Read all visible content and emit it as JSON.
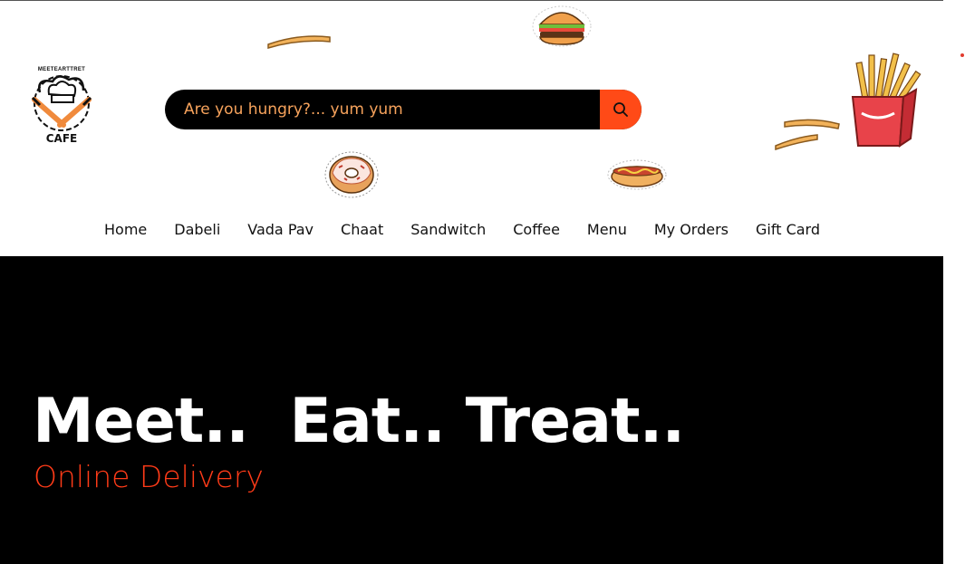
{
  "logo": {
    "top_text": "MEETEARTTRET",
    "bottom_text": "CAFE"
  },
  "search": {
    "placeholder": "Are you hungry?... yum yum",
    "value": "",
    "button_icon": "search-icon"
  },
  "nav": {
    "items": [
      {
        "label": "Home"
      },
      {
        "label": "Dabeli"
      },
      {
        "label": "Vada Pav"
      },
      {
        "label": "Chaat"
      },
      {
        "label": "Sandwitch"
      },
      {
        "label": "Coffee"
      },
      {
        "label": "Menu"
      },
      {
        "label": "My Orders"
      },
      {
        "label": "Gift Card"
      }
    ]
  },
  "hero": {
    "title": "Meet..  Eat.. Treat..",
    "subtitle": "Online Delivery"
  },
  "decorations": [
    "fries-stick-icon",
    "burger-icon",
    "fries-box-icon",
    "donut-icon",
    "hotdog-icon"
  ],
  "colors": {
    "accent": "#ff4a17",
    "placeholder": "#f7a35c",
    "hero_bg": "#000000",
    "subtitle": "#ff3b18"
  }
}
